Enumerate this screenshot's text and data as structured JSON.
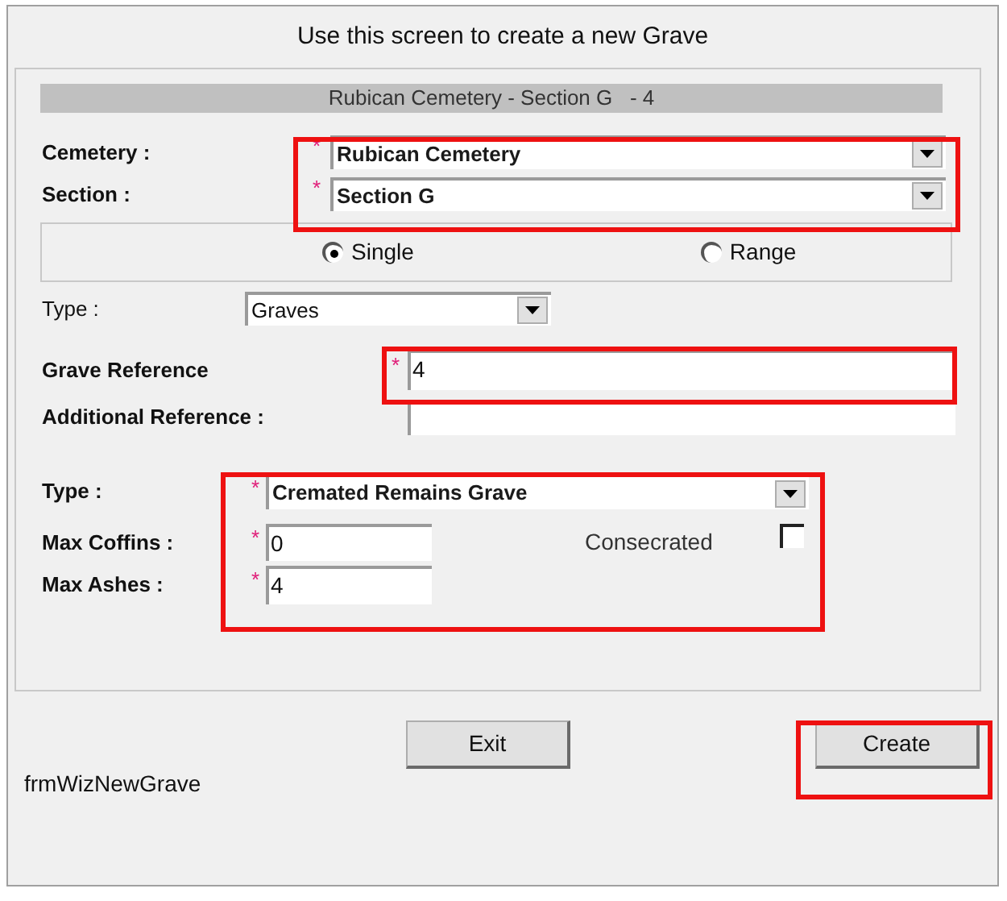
{
  "window": {
    "title": "Use this screen to create a new Grave"
  },
  "header": "Rubican Cemetery - Section G   - 4",
  "location": {
    "highlighted": true,
    "fields": [
      {
        "label": "Cemetery :",
        "marker": "*",
        "value": "Rubican Cemetery"
      },
      {
        "label": "Section :",
        "marker": "*",
        "value": "Section G"
      }
    ]
  },
  "mode": [
    {
      "label": "Single",
      "selected": true
    },
    {
      "label": "Range",
      "selected": false
    }
  ],
  "type": {
    "label": "Type :",
    "value": "Graves"
  },
  "reference": {
    "highlighted": true,
    "label": "Grave Reference",
    "marker": "*",
    "value": "4"
  },
  "additional_reference": {
    "label": "Additional Reference :"
  },
  "details": {
    "highlighted": true,
    "type": {
      "label": "Type :",
      "marker": "*",
      "value": "Cremated Remains Grave"
    },
    "max_coffins": {
      "label": "Max Coffins :",
      "marker": "*",
      "value": "0"
    },
    "consecrated": {
      "label": "Consecrated",
      "checked": false
    },
    "max_ashes": {
      "label": "Max Ashes :",
      "marker": "*",
      "value": "4"
    }
  },
  "form_name": "frmWizNewGrave",
  "buttons": [
    {
      "label": "Exit",
      "highlighted": false
    },
    {
      "label": "Create",
      "highlighted": true
    }
  ]
}
